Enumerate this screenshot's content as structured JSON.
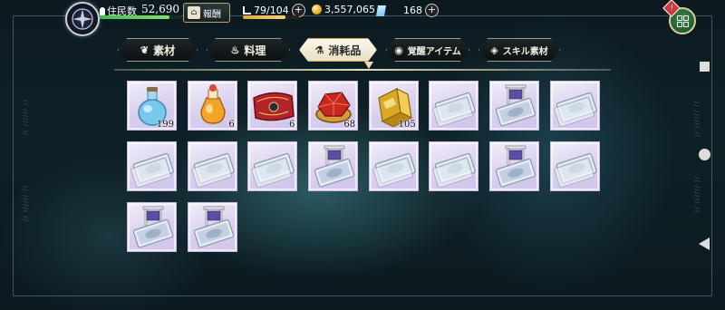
{
  "header": {
    "residents_label": "住民数",
    "residents_value": "52,690",
    "residents_bar": 0.85,
    "reward_label": "報酬",
    "stamina_value": "79/104",
    "stamina_bar": 0.76,
    "gold_value": "3,557,065",
    "gem_value": "168"
  },
  "tabs": [
    {
      "label": "素材",
      "icon": "leaf-icon",
      "active": false
    },
    {
      "label": "料理",
      "icon": "cooking-pot-icon",
      "active": false
    },
    {
      "label": "消耗品",
      "icon": "flask-icon",
      "active": true
    },
    {
      "label": "覚醒アイテム",
      "icon": "awakening-icon",
      "active": false
    },
    {
      "label": "スキル素材",
      "icon": "skill-icon",
      "active": false
    }
  ],
  "items": [
    {
      "type": "blue-potion",
      "qty": "199"
    },
    {
      "type": "orange-potion",
      "qty": "6"
    },
    {
      "type": "red-scroll",
      "qty": "6"
    },
    {
      "type": "red-gem-bowl",
      "qty": "68"
    },
    {
      "type": "gold-bar",
      "qty": "105"
    },
    {
      "type": "ticket",
      "qty": ""
    },
    {
      "type": "ticket-flag",
      "qty": ""
    },
    {
      "type": "ticket",
      "qty": ""
    },
    {
      "type": "ticket",
      "qty": ""
    },
    {
      "type": "ticket",
      "qty": ""
    },
    {
      "type": "ticket",
      "qty": ""
    },
    {
      "type": "ticket-flag",
      "qty": ""
    },
    {
      "type": "ticket",
      "qty": ""
    },
    {
      "type": "ticket",
      "qty": ""
    },
    {
      "type": "ticket-flag",
      "qty": ""
    },
    {
      "type": "ticket",
      "qty": ""
    },
    {
      "type": "ticket-flag",
      "qty": ""
    },
    {
      "type": "ticket-flag",
      "qty": ""
    }
  ],
  "badge": "!",
  "colors": {
    "cell_bg": "#d9d0ee",
    "tab_active_bg": "#fbf7ea",
    "residents_bar": "#4fcf55",
    "stamina_bar": "#f0c050"
  }
}
